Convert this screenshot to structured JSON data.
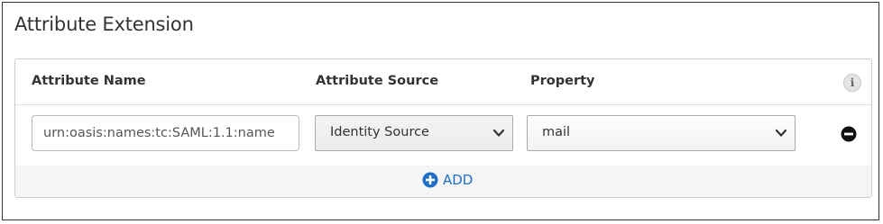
{
  "section": {
    "title": "Attribute Extension"
  },
  "table": {
    "headers": {
      "attribute_name": "Attribute Name",
      "attribute_source": "Attribute Source",
      "property": "Property"
    },
    "rows": [
      {
        "attribute_name": "urn:oasis:names:tc:SAML:1.1:name",
        "attribute_source": "Identity Source",
        "property": "mail"
      }
    ],
    "add_label": "ADD"
  },
  "icons": {
    "info": "info-icon",
    "remove": "minus-circle-icon",
    "add": "plus-circle-icon",
    "dropdown": "chevron-down-icon"
  },
  "colors": {
    "accent": "#1f6fc4",
    "text": "#333333"
  }
}
